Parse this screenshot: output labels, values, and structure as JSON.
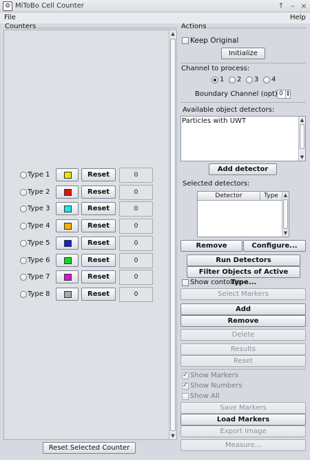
{
  "window": {
    "title": "MiToBo Cell Counter",
    "controls": [
      "↑",
      "–",
      "×"
    ]
  },
  "menu": {
    "file": "File",
    "help": "Help"
  },
  "counters": {
    "group_title": "Counters",
    "rows": [
      {
        "label": "Type 1",
        "color": "#f2e300",
        "reset": "Reset",
        "count": "0"
      },
      {
        "label": "Type 2",
        "color": "#e01010",
        "reset": "Reset",
        "count": "0"
      },
      {
        "label": "Type 3",
        "color": "#1ee8ee",
        "reset": "Reset",
        "count": "0"
      },
      {
        "label": "Type 4",
        "color": "#f5b400",
        "reset": "Reset",
        "count": "0"
      },
      {
        "label": "Type 5",
        "color": "#1020d8",
        "reset": "Reset",
        "count": "0"
      },
      {
        "label": "Type 6",
        "color": "#10d820",
        "reset": "Reset",
        "count": "0"
      },
      {
        "label": "Type 7",
        "color": "#e010e0",
        "reset": "Reset",
        "count": "0"
      },
      {
        "label": "Type 8",
        "color": "#a8a8a8",
        "reset": "Reset",
        "count": "0"
      }
    ],
    "reset_selected": "Reset Selected Counter"
  },
  "actions": {
    "group_title": "Actions",
    "keep_original": "Keep Original",
    "initialize": "Initialize",
    "channel_label": "Channel to process:",
    "channels": [
      "1",
      "2",
      "3",
      "4"
    ],
    "boundary_label": "Boundary Channel (opt):",
    "boundary_value": "0",
    "available_label": "Available object detectors:",
    "available_items": [
      "Particles with UWT"
    ],
    "add_detector": "Add detector",
    "selected_label": "Selected detectors:",
    "col_detector": "Detector",
    "col_type": "Type",
    "remove": "Remove",
    "configure": "Configure...",
    "run_detectors": "Run Detectors",
    "filter_objects": "Filter Objects of Active Type...",
    "show_contours": "Show contours",
    "select_markers": "Select Markers",
    "add": "Add",
    "remove2": "Remove",
    "delete": "Delete",
    "results": "Results",
    "reset": "Reset",
    "show_markers": "Show Markers",
    "show_numbers": "Show Numbers",
    "show_all": "Show All",
    "save_markers": "Save Markers",
    "load_markers": "Load Markers",
    "export_image": "Export Image",
    "measure": "Measure..."
  }
}
